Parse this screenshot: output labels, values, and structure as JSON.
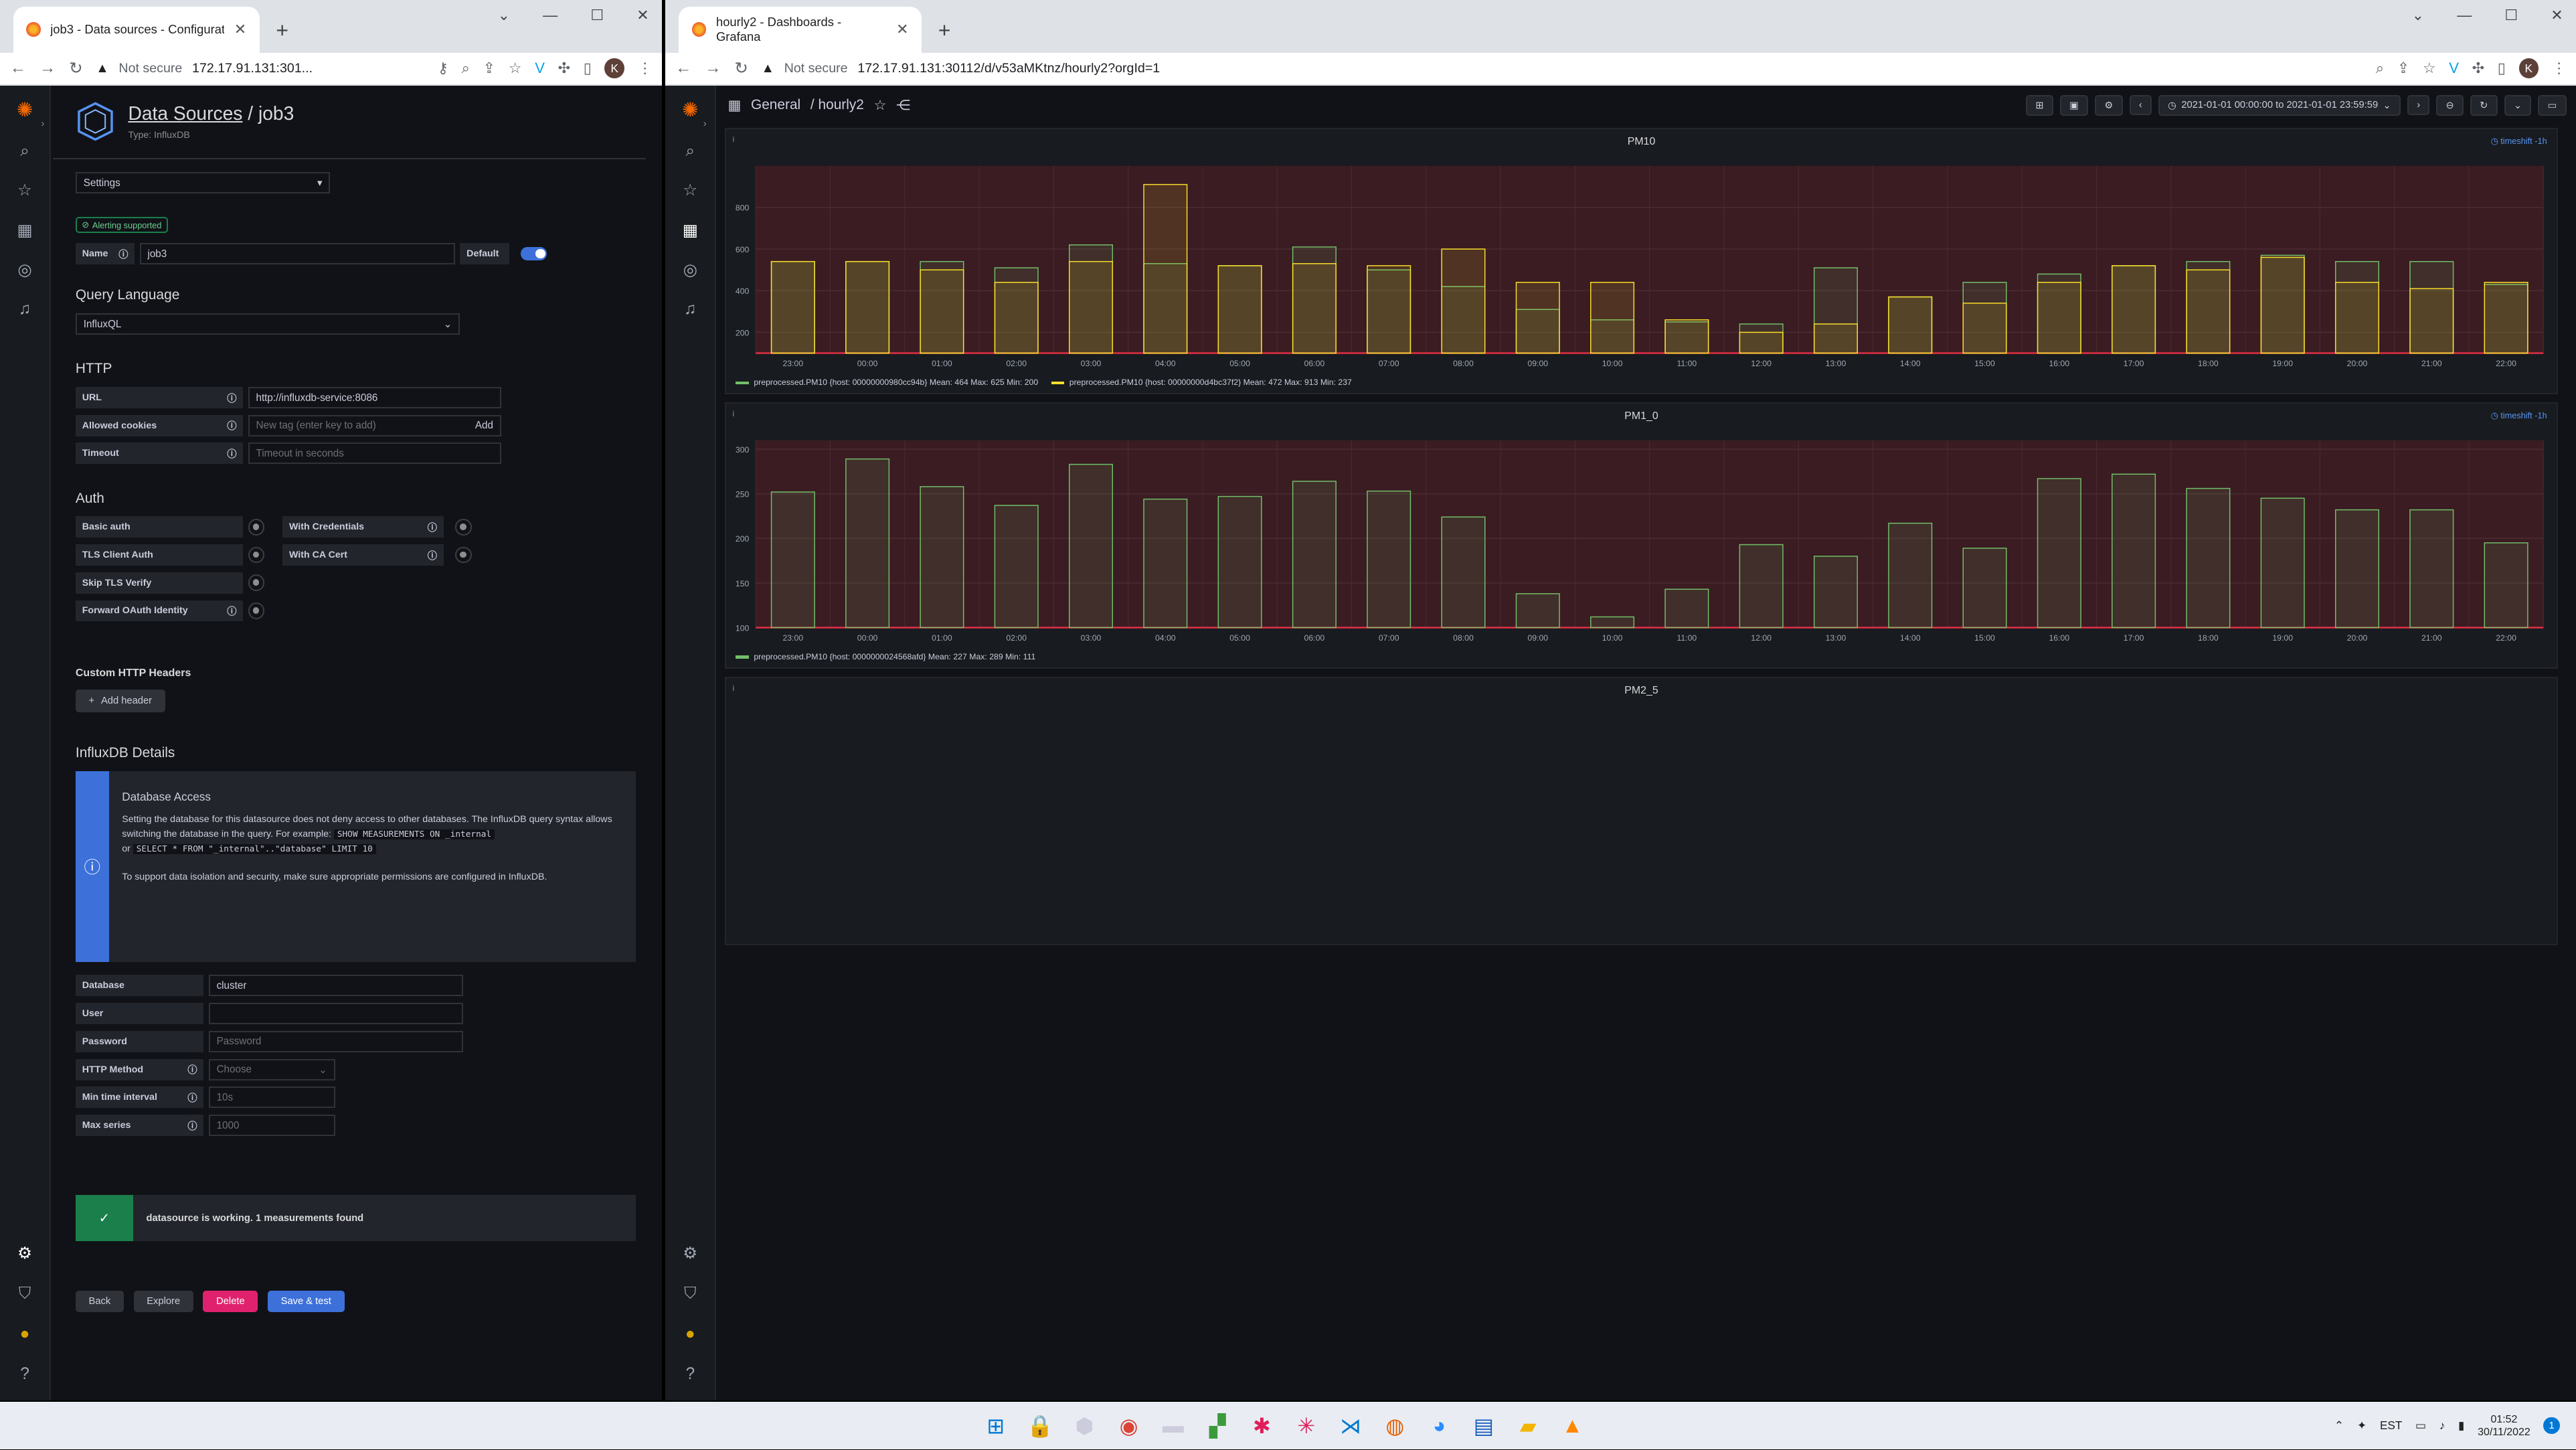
{
  "left": {
    "tab_title": "job3 - Data sources - Configurati",
    "url_secure": "Not secure",
    "url": "172.17.91.131:301...",
    "avatar": "K",
    "breadcrumb_link": "Data Sources",
    "breadcrumb_sep": "/",
    "title": "job3",
    "type_label": "Type: InfluxDB",
    "settings_select": "Settings",
    "alerting_badge": "Alerting supported",
    "name_label": "Name",
    "name_value": "job3",
    "default_label": "Default",
    "query_lang_title": "Query Language",
    "query_lang_value": "InfluxQL",
    "http_title": "HTTP",
    "url_label": "URL",
    "url_value": "http://influxdb-service:8086",
    "cookies_label": "Allowed cookies",
    "cookies_placeholder": "New tag (enter key to add)",
    "cookies_add": "Add",
    "timeout_label": "Timeout",
    "timeout_placeholder": "Timeout in seconds",
    "auth_title": "Auth",
    "basic_auth": "Basic auth",
    "with_credentials": "With Credentials",
    "tls_client_auth": "TLS Client Auth",
    "with_ca_cert": "With CA Cert",
    "skip_tls": "Skip TLS Verify",
    "forward_oauth": "Forward OAuth Identity",
    "custom_headers_title": "Custom HTTP Headers",
    "add_header": "Add header",
    "influx_title": "InfluxDB Details",
    "db_access_title": "Database Access",
    "db_access_text1": "Setting the database for this datasource does not deny access to other databases. The InfluxDB query syntax allows switching the database in the query. For example:",
    "db_access_code1": "SHOW MEASUREMENTS ON _internal",
    "db_access_or": "or",
    "db_access_code2": "SELECT * FROM \"_internal\"..\"database\" LIMIT 10",
    "db_access_text2": "To support data isolation and security, make sure appropriate permissions are configured in InfluxDB.",
    "database_label": "Database",
    "database_value": "cluster",
    "user_label": "User",
    "password_label": "Password",
    "password_placeholder": "Password",
    "http_method_label": "HTTP Method",
    "http_method_placeholder": "Choose",
    "min_time_label": "Min time interval",
    "min_time_placeholder": "10s",
    "max_series_label": "Max series",
    "max_series_placeholder": "1000",
    "status_text": "datasource is working. 1 measurements found",
    "btn_back": "Back",
    "btn_explore": "Explore",
    "btn_delete": "Delete",
    "btn_save": "Save & test"
  },
  "right": {
    "tab_title": "hourly2 - Dashboards - Grafana",
    "url_secure": "Not secure",
    "url": "172.17.91.131:30112/d/v53aMKtnz/hourly2?orgId=1",
    "avatar": "K",
    "breadcrumb_folder": "General",
    "breadcrumb_dash": "/ hourly2",
    "time_range": "2021-01-01 00:00:00 to 2021-01-01 23:59:59",
    "timeshift": "timeshift -1h",
    "panel_pm10_title": "PM10",
    "panel_pm1_title": "PM1_0",
    "panel_pm25_title": "PM2_5",
    "pm10_legend1": "preprocessed.PM10 {host: 00000000980cc94b}  Mean: 464  Max: 625  Min: 200",
    "pm10_legend2": "preprocessed.PM10 {host: 00000000d4bc37f2}  Mean: 472  Max: 913  Min: 237",
    "pm1_legend1": "preprocessed.PM10 {host: 0000000024568afd}  Mean: 227  Max: 289  Min: 111"
  },
  "colors": {
    "series_green": "#73bf69",
    "series_yellow": "#fade2a",
    "threshold_red": "#e02f44",
    "grafana_orange": "#f46800",
    "primary_blue": "#3d71d9",
    "delete_pink": "#e0226e",
    "success_green": "#1a7f4b"
  },
  "taskbar": {
    "lang": "EST",
    "time": "01:52",
    "date": "30/11/2022",
    "notif": "1"
  },
  "chart_data": [
    {
      "type": "bar",
      "title": "PM10",
      "categories": [
        "23:00",
        "00:00",
        "01:00",
        "02:00",
        "03:00",
        "04:00",
        "05:00",
        "06:00",
        "07:00",
        "08:00",
        "09:00",
        "10:00",
        "11:00",
        "12:00",
        "13:00",
        "14:00",
        "15:00",
        "16:00",
        "17:00",
        "18:00",
        "19:00",
        "20:00",
        "21:00",
        "22:00"
      ],
      "series": [
        {
          "name": "preprocessed.PM10 {host: 00000000980cc94b}",
          "values": [
            540,
            540,
            540,
            510,
            620,
            530,
            520,
            610,
            500,
            420,
            310,
            260,
            250,
            240,
            510,
            370,
            440,
            480,
            520,
            540,
            570,
            540,
            540,
            430
          ]
        },
        {
          "name": "preprocessed.PM10 {host: 00000000d4bc37f2}",
          "values": [
            540,
            540,
            500,
            440,
            540,
            910,
            520,
            530,
            520,
            600,
            440,
            440,
            260,
            200,
            240,
            370,
            340,
            440,
            520,
            500,
            560,
            440,
            410,
            440
          ]
        }
      ],
      "ylim": [
        100,
        1000
      ],
      "yticks": [
        200,
        400,
        600,
        800
      ]
    },
    {
      "type": "bar",
      "title": "PM1_0",
      "categories": [
        "23:00",
        "00:00",
        "01:00",
        "02:00",
        "03:00",
        "04:00",
        "05:00",
        "06:00",
        "07:00",
        "08:00",
        "09:00",
        "10:00",
        "11:00",
        "12:00",
        "13:00",
        "14:00",
        "15:00",
        "16:00",
        "17:00",
        "18:00",
        "19:00",
        "20:00",
        "21:00",
        "22:00"
      ],
      "series": [
        {
          "name": "preprocessed.PM10 {host: 0000000024568afd}",
          "values": [
            252,
            289,
            258,
            237,
            283,
            244,
            247,
            264,
            253,
            224,
            138,
            112,
            143,
            193,
            180,
            217,
            189,
            267,
            272,
            256,
            245,
            232,
            232,
            195
          ]
        }
      ],
      "ylim": [
        100,
        310
      ],
      "yticks": [
        100,
        150,
        200,
        250,
        300
      ]
    }
  ]
}
